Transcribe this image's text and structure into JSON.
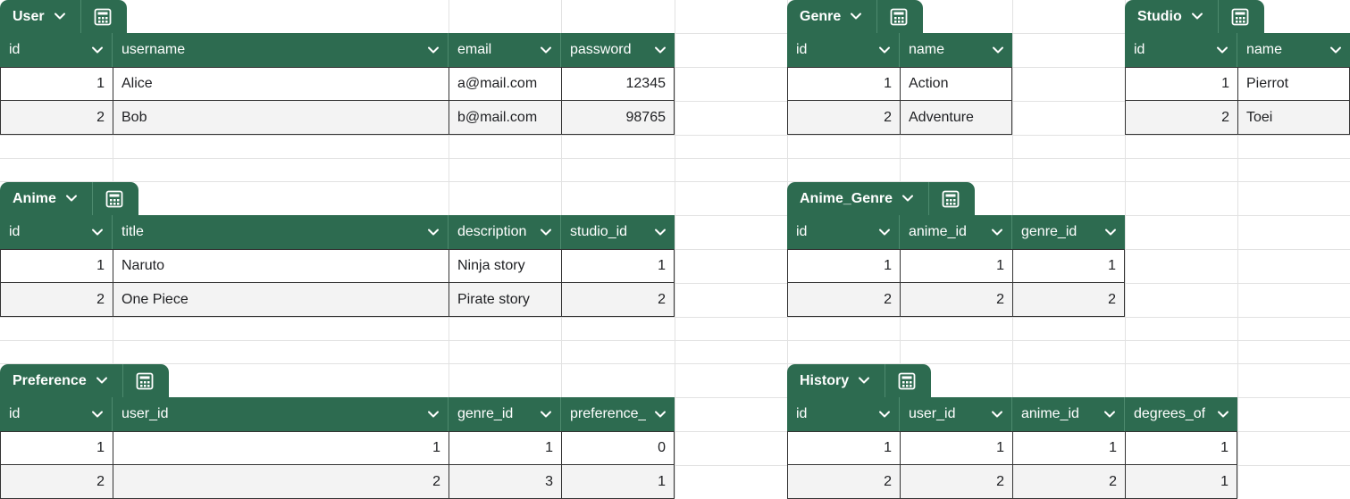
{
  "tables": {
    "user": {
      "name": "User",
      "columns": [
        "id",
        "username",
        "email",
        "password"
      ],
      "rows": [
        [
          "1",
          "Alice",
          "a@mail.com",
          "12345"
        ],
        [
          "2",
          "Bob",
          "b@mail.com",
          "98765"
        ]
      ]
    },
    "genre": {
      "name": "Genre",
      "columns": [
        "id",
        "name"
      ],
      "rows": [
        [
          "1",
          "Action"
        ],
        [
          "2",
          "Adventure"
        ]
      ]
    },
    "studio": {
      "name": "Studio",
      "columns": [
        "id",
        "name"
      ],
      "rows": [
        [
          "1",
          "Pierrot"
        ],
        [
          "2",
          "Toei"
        ]
      ]
    },
    "anime": {
      "name": "Anime",
      "columns": [
        "id",
        "title",
        "description",
        "studio_id"
      ],
      "rows": [
        [
          "1",
          "Naruto",
          "Ninja story",
          "1"
        ],
        [
          "2",
          "One Piece",
          "Pirate story",
          "2"
        ]
      ]
    },
    "anime_genre": {
      "name": "Anime_Genre",
      "columns": [
        "id",
        "anime_id",
        "genre_id"
      ],
      "rows": [
        [
          "1",
          "1",
          "1"
        ],
        [
          "2",
          "2",
          "2"
        ]
      ]
    },
    "preference": {
      "name": "Preference",
      "columns": [
        "id",
        "user_id",
        "genre_id",
        "preference_"
      ],
      "rows": [
        [
          "1",
          "1",
          "1",
          "0"
        ],
        [
          "2",
          "2",
          "3",
          "1"
        ]
      ]
    },
    "history": {
      "name": "History",
      "columns": [
        "id",
        "user_id",
        "anime_id",
        "degrees_of"
      ],
      "rows": [
        [
          "1",
          "1",
          "1",
          "1"
        ],
        [
          "2",
          "2",
          "2",
          "1"
        ]
      ]
    }
  },
  "icons": {
    "dropdown": "chevron-down-icon",
    "table_menu": "table-calculator-icon"
  },
  "colors": {
    "header_green": "#2d6b50",
    "header_text": "#ffffff",
    "alt_row": "#f3f3f3",
    "gridline": "#e2e2e2"
  }
}
